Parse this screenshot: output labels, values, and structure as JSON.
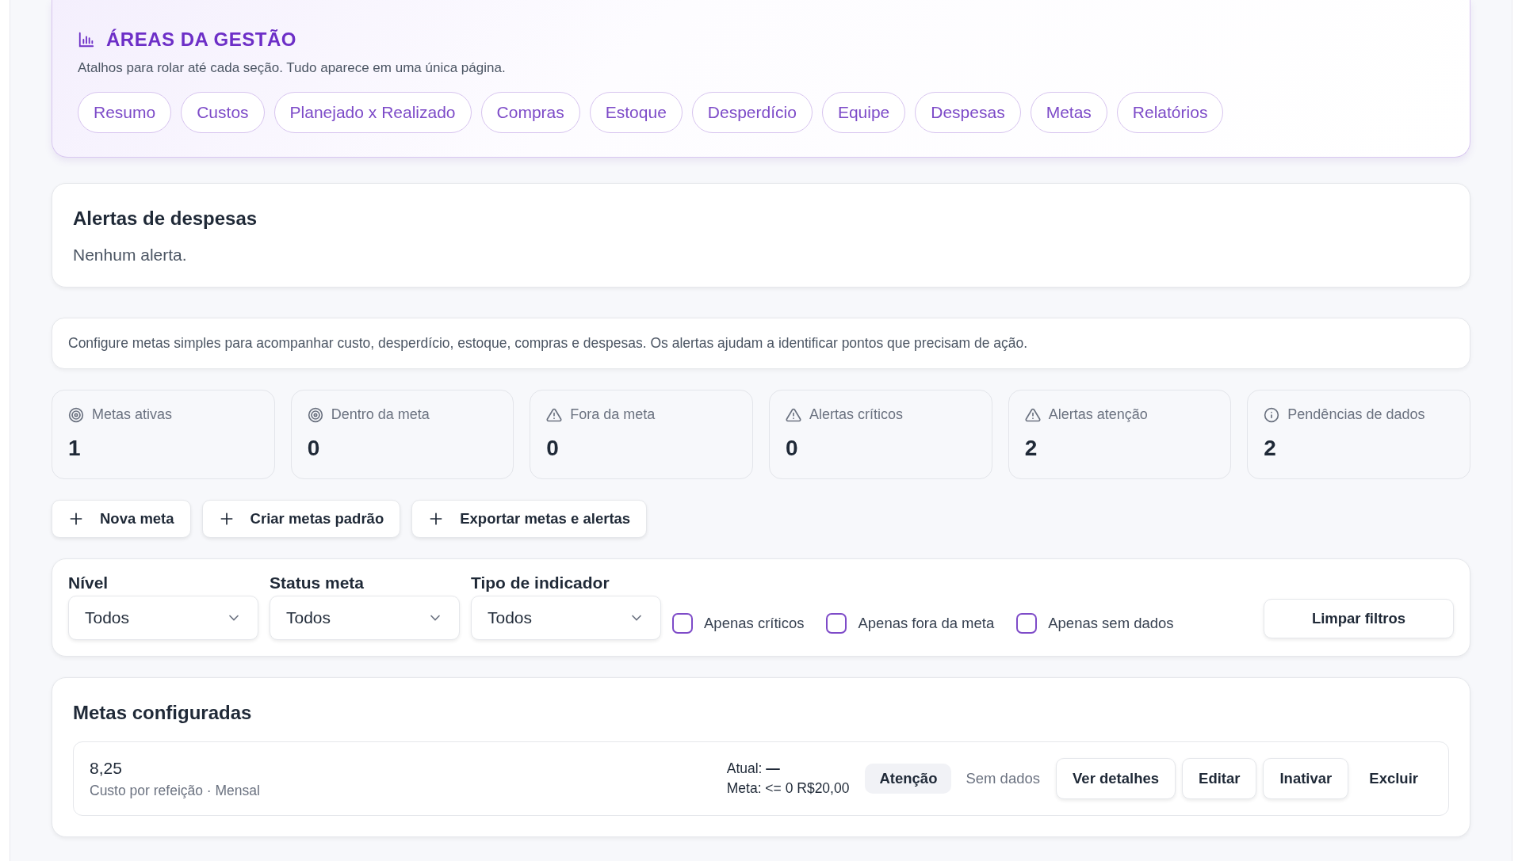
{
  "areas": {
    "title": "ÁREAS DA GESTÃO",
    "subtitle": "Atalhos para rolar até cada seção. Tudo aparece em uma única página.",
    "chips": [
      {
        "label": "Resumo"
      },
      {
        "label": "Custos"
      },
      {
        "label": "Planejado x Realizado"
      },
      {
        "label": "Compras"
      },
      {
        "label": "Estoque"
      },
      {
        "label": "Desperdício"
      },
      {
        "label": "Equipe"
      },
      {
        "label": "Despesas"
      },
      {
        "label": "Metas"
      },
      {
        "label": "Relatórios"
      }
    ]
  },
  "alerts": {
    "title": "Alertas de despesas",
    "empty": "Nenhum alerta."
  },
  "info": "Configure metas simples para acompanhar custo, desperdício, estoque, compras e despesas. Os alertas ajudam a identificar pontos que precisam de ação.",
  "stats": [
    {
      "kind": "target",
      "label": "Metas ativas",
      "value": "1"
    },
    {
      "kind": "target",
      "label": "Dentro da meta",
      "value": "0"
    },
    {
      "kind": "warning",
      "label": "Fora da meta",
      "value": "0"
    },
    {
      "kind": "warning",
      "label": "Alertas críticos",
      "value": "0"
    },
    {
      "kind": "warning",
      "label": "Alertas atenção",
      "value": "2"
    },
    {
      "kind": "info",
      "label": "Pendências de dados",
      "value": "2"
    }
  ],
  "actions": [
    "Nova meta",
    "Criar metas padrão",
    "Exportar metas e alertas"
  ],
  "filters": {
    "selects": [
      {
        "label": "Nível",
        "value": "Todos"
      },
      {
        "label": "Status meta",
        "value": "Todos"
      },
      {
        "label": "Tipo de indicador",
        "value": "Todos"
      }
    ],
    "checkboxes": [
      {
        "label": "Apenas críticos",
        "checked": false
      },
      {
        "label": "Apenas fora da meta",
        "checked": false
      },
      {
        "label": "Apenas sem dados",
        "checked": false
      }
    ],
    "clear": "Limpar filtros"
  },
  "goals": {
    "title": "Metas configuradas",
    "rows": [
      {
        "value": "8,25",
        "subtitle": "Custo por refeição · Mensal",
        "current_label": "Atual:",
        "current": "—",
        "target": "Meta: <= 0 R$20,00",
        "badge": "Atenção",
        "status": "Sem dados",
        "buttons": [
          "Ver detalhes",
          "Editar",
          "Inativar"
        ],
        "delete": "Excluir"
      }
    ]
  }
}
